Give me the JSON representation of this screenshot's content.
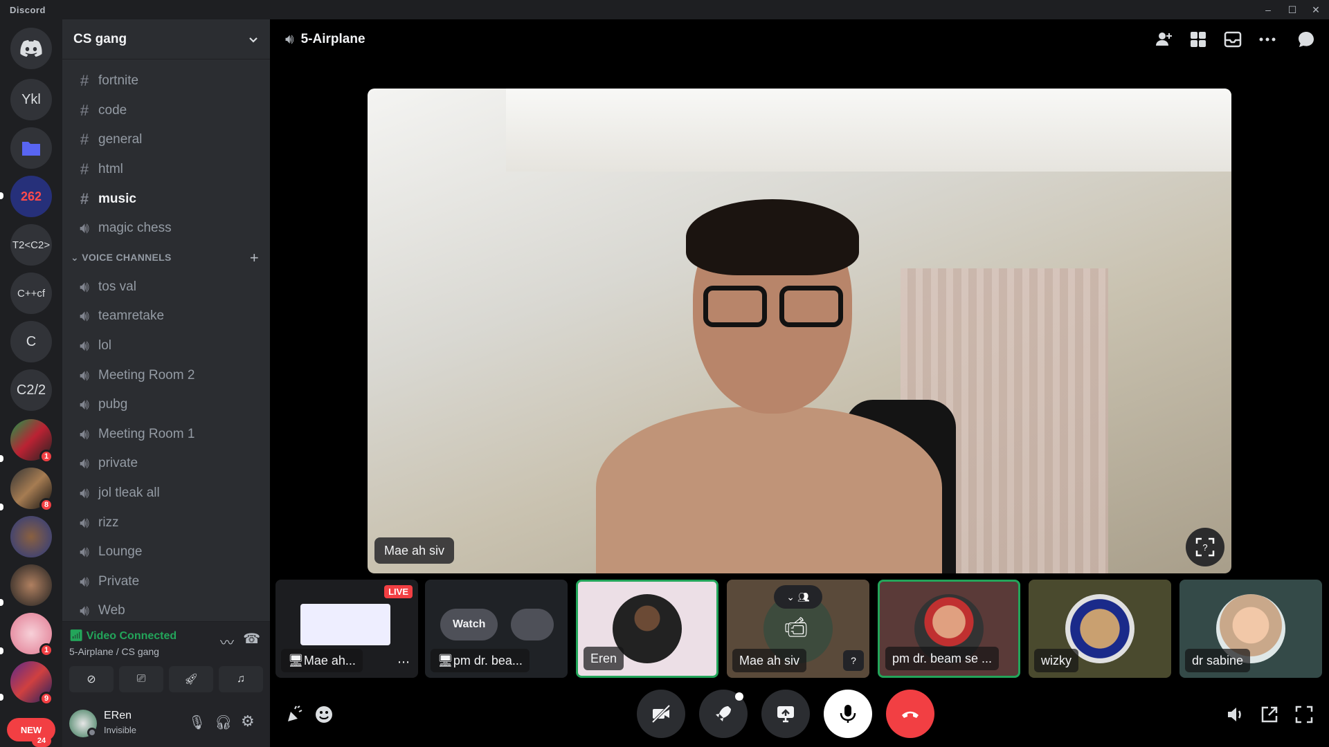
{
  "titlebar": {
    "app": "Discord",
    "min": "–",
    "max": "☐",
    "close": "✕"
  },
  "servers": [
    {
      "label": "Ykl"
    },
    {
      "label": "T2<C2>"
    },
    {
      "label": "C++cf"
    },
    {
      "label": "C"
    },
    {
      "label": "C2/2"
    }
  ],
  "server_badges": {
    "b1": "1",
    "b2": "8",
    "b3": "1",
    "b4": "9",
    "new": "NEW",
    "new_count": "24"
  },
  "guild": {
    "name": "CS gang"
  },
  "channels": [
    {
      "label": "fortnite",
      "type": "text"
    },
    {
      "label": "code",
      "type": "text"
    },
    {
      "label": "general",
      "type": "text"
    },
    {
      "label": "html",
      "type": "text"
    },
    {
      "label": "music",
      "type": "text"
    },
    {
      "label": "magic chess",
      "type": "voice"
    }
  ],
  "voice_category": "VOICE CHANNELS",
  "voice_channels": [
    {
      "label": "tos val"
    },
    {
      "label": "teamretake"
    },
    {
      "label": "lol"
    },
    {
      "label": "Meeting Room 2"
    },
    {
      "label": "pubg"
    },
    {
      "label": "Meeting Room 1"
    },
    {
      "label": "private"
    },
    {
      "label": "jol tleak all"
    },
    {
      "label": "rizz"
    },
    {
      "label": "Lounge"
    },
    {
      "label": "Private"
    },
    {
      "label": "Web"
    }
  ],
  "voice_panel": {
    "status": "Video Connected",
    "channel": "5-Airplane / CS gang"
  },
  "user": {
    "name": "ERen",
    "status": "Invisible"
  },
  "header": {
    "channel": "5-Airplane"
  },
  "stage": {
    "name": "Mae ah siv"
  },
  "tiles": [
    {
      "label": "Mae ah...",
      "live": "LIVE"
    },
    {
      "label": "pm dr. bea...",
      "watch": "Watch"
    },
    {
      "label": "Eren"
    },
    {
      "label": "Mae ah siv"
    },
    {
      "label": "pm dr. beam se ..."
    },
    {
      "label": "wizky"
    },
    {
      "label": "dr sabine"
    }
  ],
  "colors": {
    "green": "#23a55a",
    "red": "#f23f43",
    "blurple": "#5865f2"
  }
}
